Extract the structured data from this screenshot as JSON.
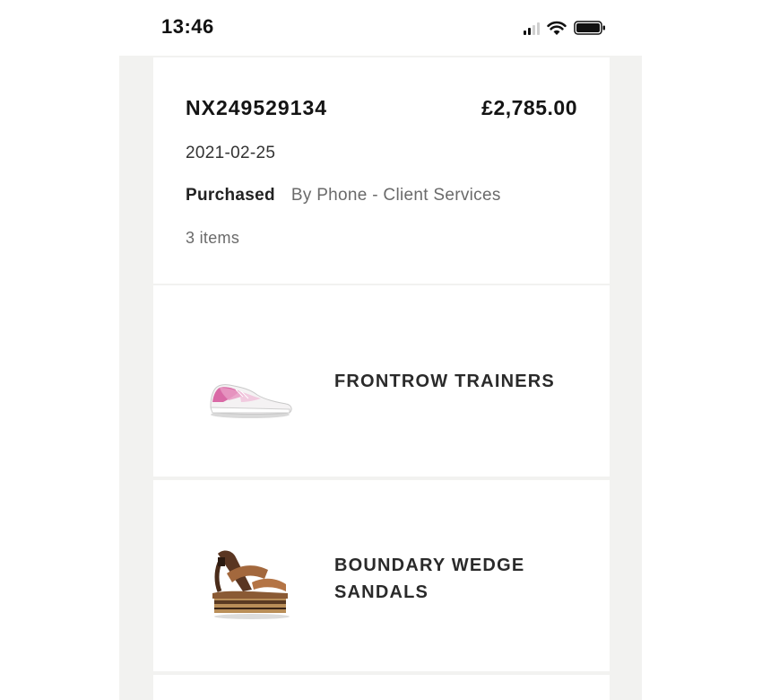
{
  "status_bar": {
    "time": "13:46",
    "icons": [
      "signal-icon",
      "wifi-icon",
      "battery-icon"
    ]
  },
  "order": {
    "number": "NX249529134",
    "total": "£2,785.00",
    "date": "2021-02-25",
    "status": "Purchased",
    "channel": "By Phone - Client Services",
    "items_count": "3 items"
  },
  "products": [
    {
      "name": "FRONTROW TRAINERS",
      "image": "pink-white-sneaker"
    },
    {
      "name": "BOUNDARY WEDGE SANDALS",
      "image": "brown-wedge-sandal"
    }
  ],
  "colors": {
    "background": "#f2f2f0",
    "card": "#ffffff",
    "text": "#141414",
    "muted": "#6a6a6a"
  }
}
